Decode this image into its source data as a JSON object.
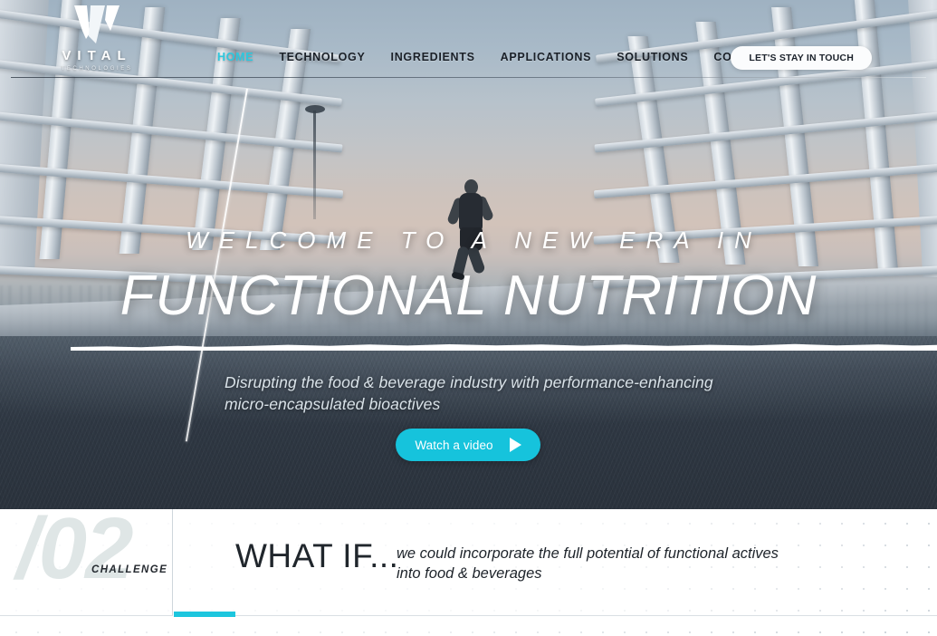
{
  "brand": {
    "logo_icon": "vital-v-logo-icon",
    "name": "VITAL",
    "tagline": "TECHNOLOGIES"
  },
  "nav": {
    "items": [
      {
        "label": "HOME",
        "active": true
      },
      {
        "label": "TECHNOLOGY",
        "active": false
      },
      {
        "label": "INGREDIENTS",
        "active": false
      },
      {
        "label": "APPLICATIONS",
        "active": false
      },
      {
        "label": "SOLUTIONS",
        "active": false
      },
      {
        "label": "COMPANY",
        "active": false
      }
    ],
    "cta_label": "LET'S STAY IN TOUCH"
  },
  "hero": {
    "eyebrow": "WELCOME TO A NEW ERA IN",
    "headline": "FUNCTIONAL NUTRITION",
    "subcopy": "Disrupting the food & beverage industry with performance-enhancing micro-encapsulated bioactives",
    "video_button_label": "Watch a video",
    "play_icon": "play-triangle-icon",
    "background_description": "runner-on-bridge-photo"
  },
  "challenge": {
    "number": "/02",
    "label": "CHALLENGE",
    "heading": "WHAT IF...",
    "body": "we could incorporate the full potential of functional actives into food & beverages"
  },
  "colors": {
    "accent_cyan": "#16c3dc",
    "nav_active": "#2ec8de",
    "bar_cyan": "#1dc6de",
    "dark_text": "#20262c",
    "ghost_number": "#dfe6e6"
  }
}
